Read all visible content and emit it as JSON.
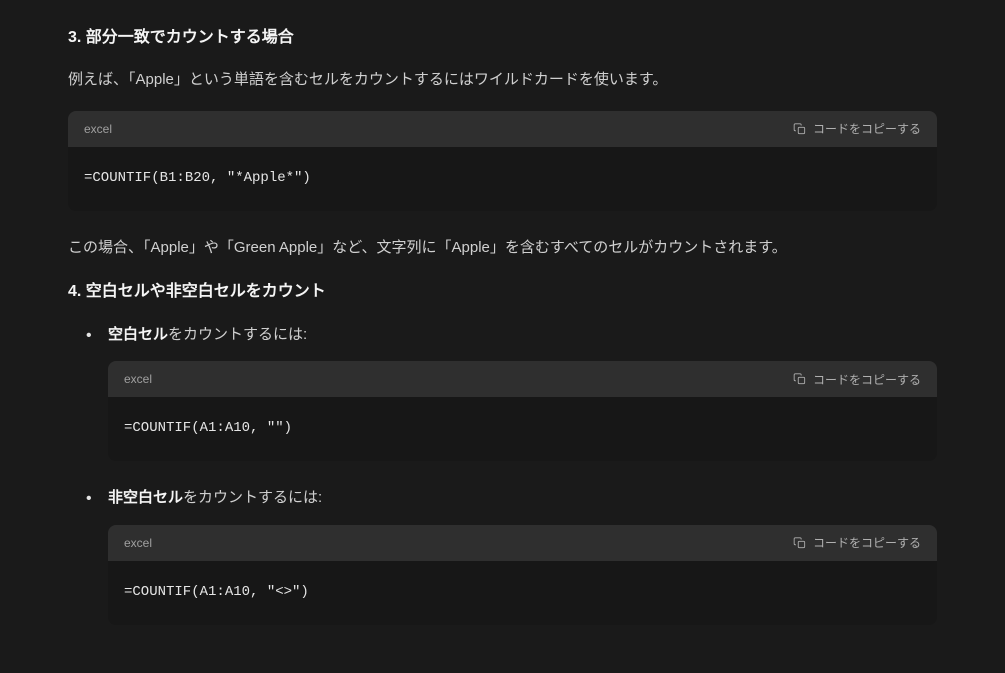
{
  "section3": {
    "heading": "3. 部分一致でカウントする場合",
    "intro": "例えば、「Apple」という単語を含むセルをカウントするにはワイルドカードを使います。",
    "code": {
      "lang": "excel",
      "copy_label": "コードをコピーする",
      "content": "=COUNTIF(B1:B20, \"*Apple*\")"
    },
    "explanation": "この場合、「Apple」や「Green Apple」など、文字列に「Apple」を含むすべてのセルがカウントされます。"
  },
  "section4": {
    "heading": "4. 空白セルや非空白セルをカウント",
    "items": [
      {
        "label_bold": "空白セル",
        "label_rest": "をカウントするには:",
        "code": {
          "lang": "excel",
          "copy_label": "コードをコピーする",
          "content": "=COUNTIF(A1:A10, \"\")"
        }
      },
      {
        "label_bold": "非空白セル",
        "label_rest": "をカウントするには:",
        "code": {
          "lang": "excel",
          "copy_label": "コードをコピーする",
          "content": "=COUNTIF(A1:A10, \"<>\")"
        }
      }
    ]
  }
}
